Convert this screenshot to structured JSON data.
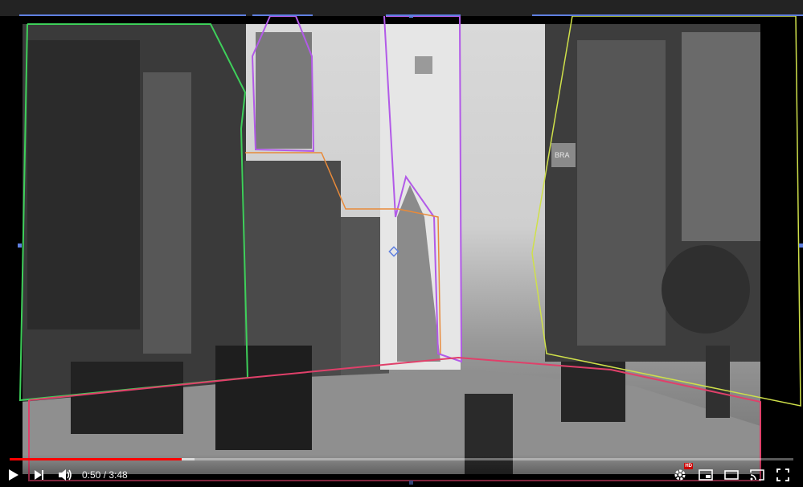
{
  "player": {
    "current_time": "0:50",
    "time_separator": " / ",
    "duration": "3:48",
    "progress": 0.219,
    "buffered": 0.236
  },
  "controls": {
    "play_icon": "play-icon",
    "next_icon": "next-icon",
    "volume_icon": "volume-icon",
    "settings_icon": "settings-gear-icon",
    "hd_badge": "HD",
    "miniplayer_icon": "miniplayer-icon",
    "theater_icon": "theater-mode-icon",
    "cast_icon": "cast-icon",
    "fullscreen_icon": "fullscreen-icon"
  },
  "colors": {
    "progress_played": "#ff0000",
    "outline_green": "#3ecf5a",
    "outline_purple": "#b25ae8",
    "outline_orange": "#e88a3a",
    "outline_red": "#e0406a",
    "outline_yellow": "#cfe04a",
    "outline_blue": "#5f7fe0"
  },
  "signs": {
    "storefront": "BRA"
  }
}
